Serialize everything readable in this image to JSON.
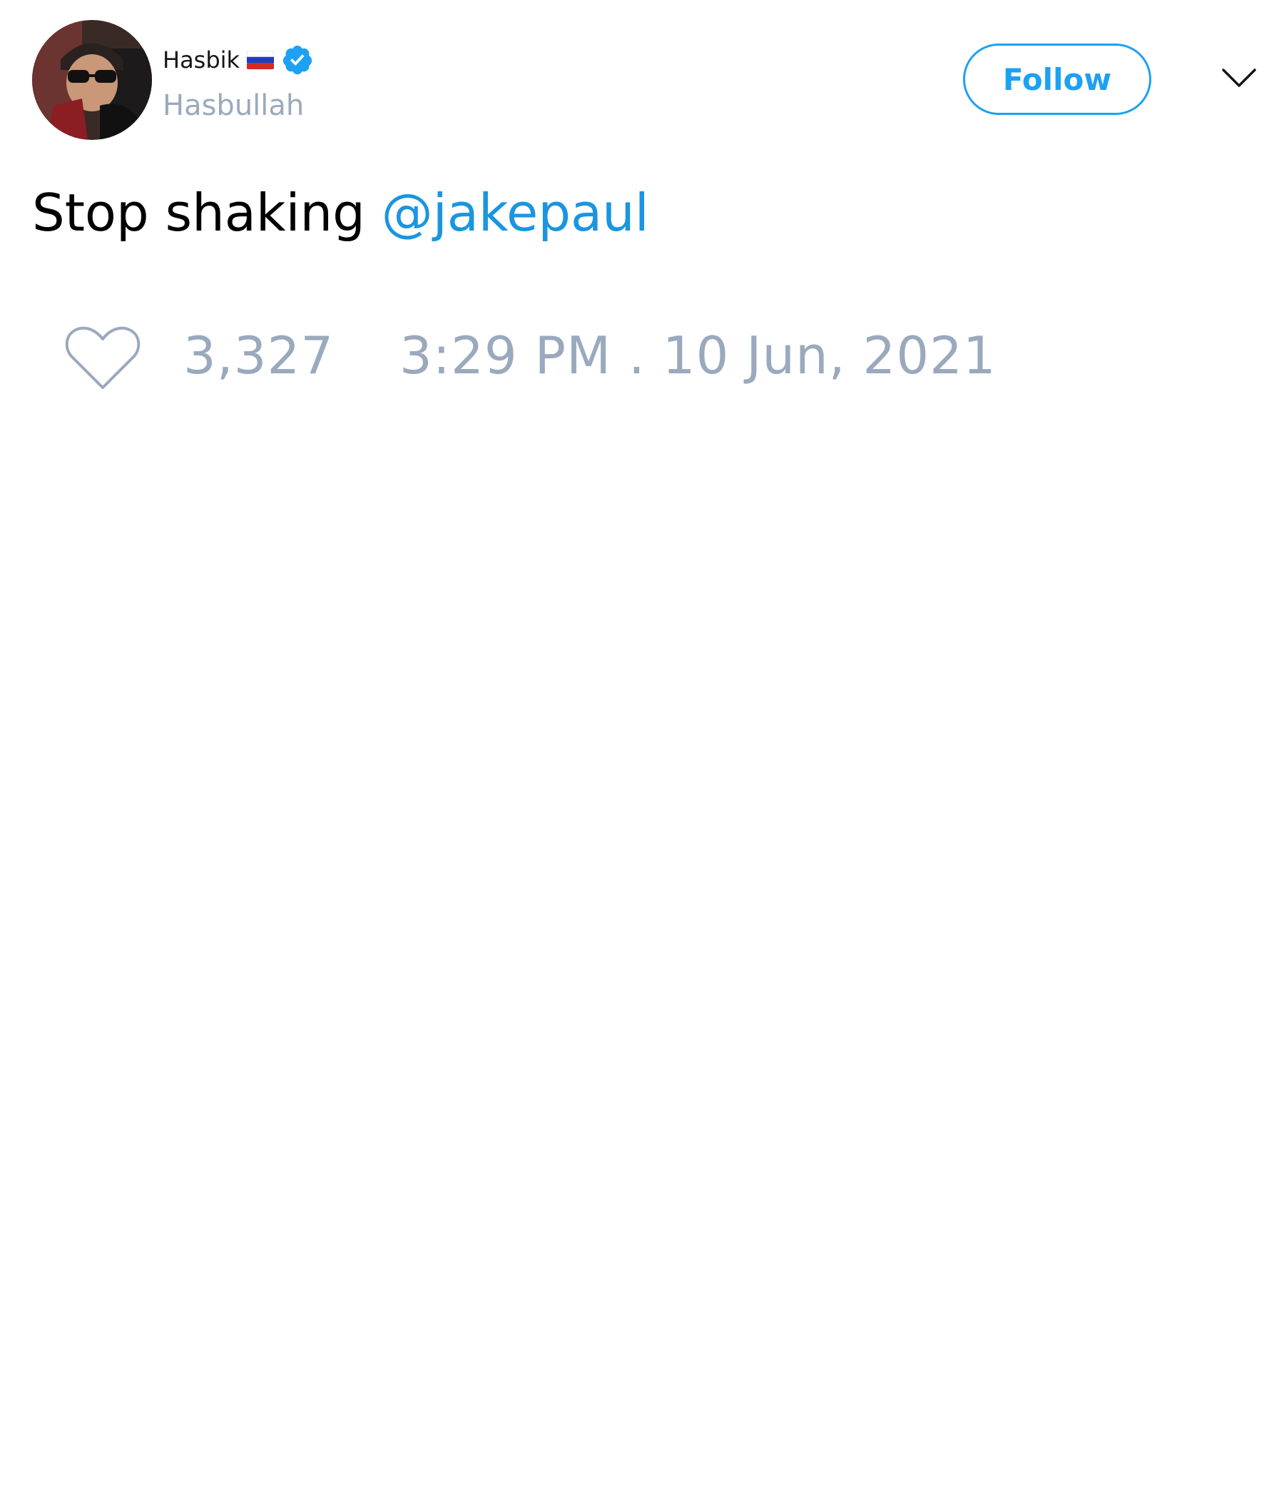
{
  "author": {
    "display_name": "Hasbik",
    "handle": "Hasbullah",
    "flag_icon": "russia-flag-icon",
    "verified_icon": "verified-badge-icon",
    "avatar_icon": "profile-photo"
  },
  "actions": {
    "follow_label": "Follow",
    "menu_icon": "chevron-down-icon"
  },
  "tweet": {
    "text": "Stop shaking ",
    "mention": "@jakepaul"
  },
  "stats": {
    "like_icon": "heart-icon",
    "likes": "3,327",
    "timestamp": "3:29 PM . 10 Jun, 2021"
  },
  "colors": {
    "accent": "#1da1f2",
    "mention": "#1b95e0",
    "muted": "#9aa9bd",
    "text": "#14171a"
  }
}
